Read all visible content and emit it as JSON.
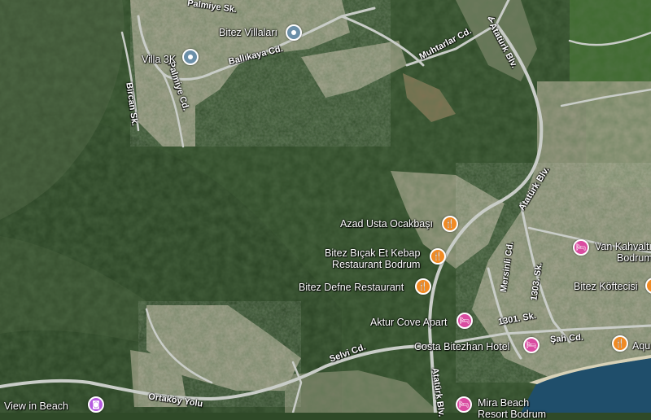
{
  "map": {
    "colors": {
      "forest": "#2f4a28",
      "forest_dark": "#263f22",
      "forest_light": "#4e6a3d",
      "built_up": "#a9a58f",
      "road": "#c9cdc8",
      "sea": "#1f4e6b",
      "food_pin": "#f08a23",
      "hotel_pin": "#d94ba0",
      "place_pin": "#6b8fa8",
      "photo_pin": "#b65be0"
    },
    "streets": {
      "palmiye_top": "Palmiye Sk.",
      "palmiye_cd": "Palmiye Cd.",
      "ballikaya": "Ballıkaya Cd.",
      "muhtarlar": "Muhtarlar Cd.",
      "ataturk_top": "Atatürk Blv.",
      "ataturk_mid": "Atatürk Blv.",
      "bircan": "Bircan Sk.",
      "mersinli": "Mersinli Cd.",
      "s1303": "1303. Sk.",
      "s1301": "1301. Sk.",
      "sah": "Şah Cd.",
      "selvi": "Selvi Cd.",
      "ortakoy": "Ortaköy Yolu",
      "ataturk_bottom": "Atatürk Blv."
    },
    "pois": {
      "bitez_villalari": {
        "name": "Bitez Villaları",
        "icon": "place-pin-icon"
      },
      "villa_3k": {
        "name": "Villa 3K",
        "icon": "place-pin-icon"
      },
      "azad_usta": {
        "name": "Azad Usta Ocakbaşı",
        "icon": "restaurant-icon"
      },
      "bitez_bicak_1": {
        "name": "Bitez Bıçak Et Kebap",
        "icon": "restaurant-icon"
      },
      "bitez_bicak_2": "Restaurant Bodrum",
      "bitez_defne": {
        "name": "Bitez Defne Restaurant",
        "icon": "restaurant-icon"
      },
      "van_kahvalti_1": {
        "name": "Van Kahvaltı",
        "icon": "hotel-icon"
      },
      "van_kahvalti_2": "Bodrum",
      "bitez_koftecisi": {
        "name": "Bitez Köftecisi",
        "icon": "restaurant-icon"
      },
      "aktur_cove": {
        "name": "Aktur Cove Apart",
        "icon": "hotel-icon"
      },
      "costa_bitezhan": {
        "name": "Costa Bitezhan Hotel",
        "icon": "hotel-icon"
      },
      "aqua": {
        "name": "Aqu",
        "icon": "restaurant-icon"
      },
      "view_in_beach": {
        "name": "View in Beach",
        "icon": "camera-icon"
      },
      "mira_beach_1": {
        "name": "Mira Beach",
        "icon": "hotel-icon"
      },
      "mira_beach_2": "Resort Bodrum"
    }
  }
}
